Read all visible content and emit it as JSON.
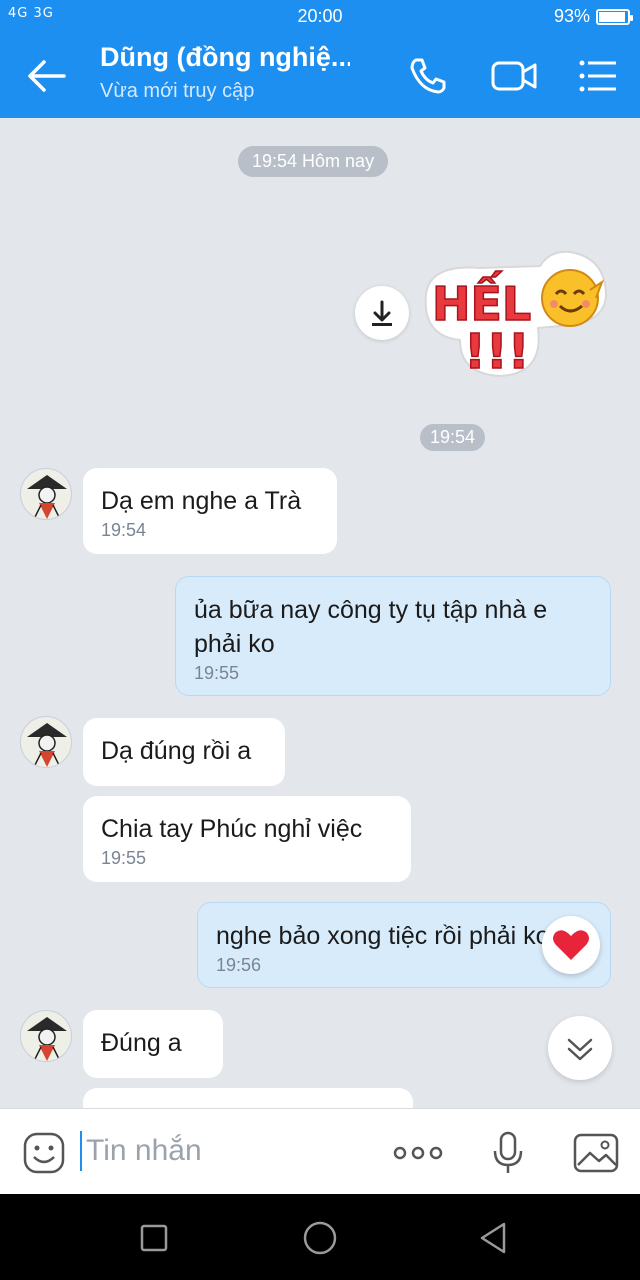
{
  "status_bar": {
    "signal": "4G 3G",
    "time": "20:00",
    "battery_percent": "93%",
    "battery_level": 0.93
  },
  "header": {
    "title": "Dũng (đồng nghiệ...",
    "subtitle": "Vừa mới truy cập",
    "icons": [
      "back-arrow-icon",
      "phone-icon",
      "video-call-icon",
      "menu-icon"
    ]
  },
  "chat": {
    "date_separator": "19:54 Hôm nay",
    "sticker_time": "19:54",
    "sticker_text": "HẾLÔ !!!",
    "messages": [
      {
        "from": "other",
        "text": "Dạ em nghe a Trà",
        "time": "19:54"
      },
      {
        "from": "me",
        "text": "ủa bữa nay công ty tụ tập nhà e phải ko",
        "time": "19:55"
      },
      {
        "from": "other",
        "text": "Dạ đúng rồi a",
        "time": ""
      },
      {
        "from": "other",
        "text": "Chia tay Phúc nghỉ việc",
        "time": "19:55"
      },
      {
        "from": "me",
        "text": "nghe bảo xong tiệc rồi phải ko",
        "time": "19:56"
      },
      {
        "from": "other",
        "text": "Đúng a",
        "time": ""
      }
    ]
  },
  "input_bar": {
    "placeholder": "Tin nhắn",
    "icons": [
      "emoji-icon",
      "more-icon",
      "microphone-icon",
      "image-icon"
    ]
  },
  "colors": {
    "accent": "#1c8ff0",
    "background": "#e3e7ec",
    "my_bubble": "#d7ebfb",
    "other_bubble": "#ffffff"
  }
}
